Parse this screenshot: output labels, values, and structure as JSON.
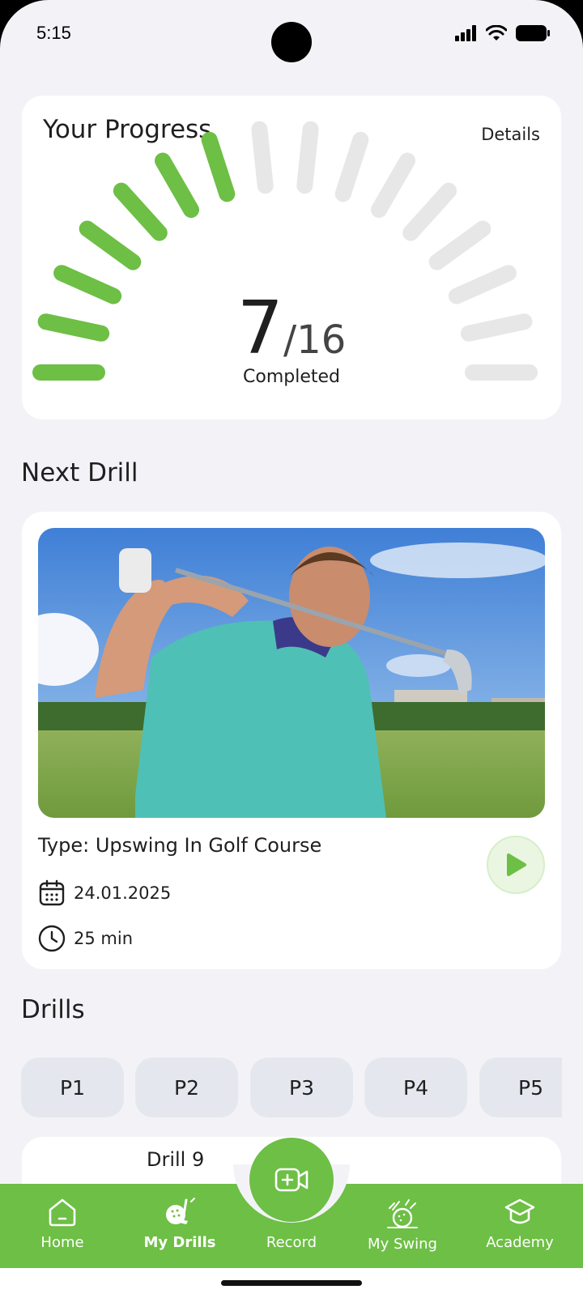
{
  "status_bar": {
    "time": "5:15"
  },
  "progress": {
    "title": "Your Progress",
    "details_label": "Details",
    "completed": 7,
    "total": 16,
    "completed_text": "7",
    "total_text": "/16",
    "label": "Completed",
    "colors": {
      "done": "#6dbf45",
      "todo": "#e7e7e7"
    }
  },
  "next_drill": {
    "section_title": "Next Drill",
    "type": "Type: Upswing In Golf Course",
    "date": "24.01.2025",
    "duration": "25 min"
  },
  "drills": {
    "section_title": "Drills",
    "tabs": [
      "P1",
      "P2",
      "P3",
      "P4",
      "P5"
    ],
    "first_item_title": "Drill 9"
  },
  "bottom_nav": {
    "items": [
      {
        "label": "Home",
        "icon": "home-icon"
      },
      {
        "label": "My Drills",
        "icon": "golf-ball-icon",
        "active": true
      },
      {
        "label": "Record",
        "icon": "video-add-icon"
      },
      {
        "label": "My Swing",
        "icon": "swing-icon"
      },
      {
        "label": "Academy",
        "icon": "academy-icon"
      }
    ]
  },
  "colors": {
    "accent": "#6dbf45",
    "background": "#f3f3f7",
    "tab_bg": "#e4e8ee"
  }
}
